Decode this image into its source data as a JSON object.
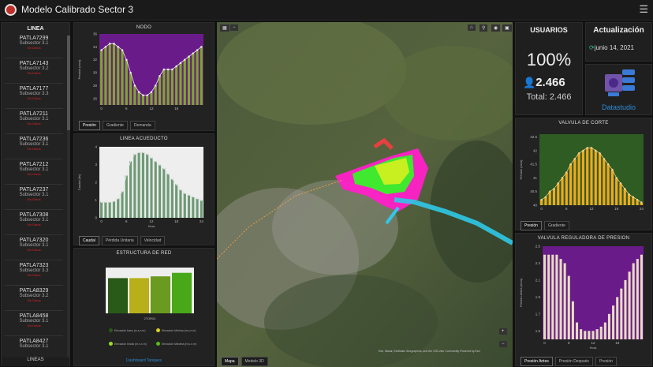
{
  "app": {
    "title": "Modelo Calibrado Sector 3"
  },
  "sidebar": {
    "header": "LINEA",
    "footer": "LINEAS",
    "items": [
      {
        "name": "PATLA7299",
        "sub": "Subsector 3.1",
        "val": "Sin Datos"
      },
      {
        "name": "PATLA7143",
        "sub": "Subsector 3.2",
        "val": "Sin Datos"
      },
      {
        "name": "PATLA7177",
        "sub": "Subsector 3.3",
        "val": "Sin Datos"
      },
      {
        "name": "PATLA7211",
        "sub": "Subsector 3.1",
        "val": "Sin Datos"
      },
      {
        "name": "PATLA7236",
        "sub": "Subsector 3.1",
        "val": "Sin Datos"
      },
      {
        "name": "PATLA7212",
        "sub": "Subsector 3.1",
        "val": "Sin Datos"
      },
      {
        "name": "PATLA7237",
        "sub": "Subsector 3.1",
        "val": "Sin Datos"
      },
      {
        "name": "PATLA7308",
        "sub": "Subsector 3.1",
        "val": "Sin Datos"
      },
      {
        "name": "PATLA7320",
        "sub": "Subsector 3.1",
        "val": "Sin Datos"
      },
      {
        "name": "PATLA7323",
        "sub": "Subsector 3.3",
        "val": "Sin Datos"
      },
      {
        "name": "PATLA8329",
        "sub": "Subsector 3.2",
        "val": "Sin Datos"
      },
      {
        "name": "PATLA8458",
        "sub": "Subsector 3.1",
        "val": "Sin Datos"
      },
      {
        "name": "PATLA8427",
        "sub": "Subsector 3.1",
        "val": ""
      }
    ]
  },
  "nodo": {
    "title": "NODO",
    "tabs": [
      "Presión",
      "Gradiente",
      "Demanda"
    ]
  },
  "acueducto": {
    "title": "LINEA ACUEDUCTO",
    "tabs": [
      "Caudal",
      "Pérdida Unitaria",
      "Velocidad"
    ],
    "xlabel": "Hora"
  },
  "estructura": {
    "title": "ESTRUCTURA DE RED",
    "link": "Dashboard Tanques",
    "legend": [
      "Elevación base (m.s.n.m)",
      "Elevación Mínima (m.s.n.m)",
      "Elevación Inicial (m.s.n.m)",
      "Elevación Máxima (m.s.n.m)"
    ]
  },
  "map": {
    "tabs": [
      "Mapa",
      "Modelo 3D"
    ],
    "attribution": "Esri, Maxar, Earthstar Geographics, and the GIS User Community   Powered by Esri"
  },
  "usuarios": {
    "label": "USUARIOS",
    "percent": "100%",
    "count": "2.466",
    "total": "Total: 2.466"
  },
  "actualizacion": {
    "label": "Actualización",
    "date": "junio 14, 2021"
  },
  "datastudio": {
    "label": "Datastudio"
  },
  "valvula_corte": {
    "title": "VALVULA DE CORTE",
    "tabs": [
      "Presión",
      "Gradiente"
    ],
    "xlabel": "Hora"
  },
  "valvula_reg": {
    "title": "VALVULA REGULADORA DE PRESION",
    "tabs": [
      "Presión Antes",
      "Presión Después",
      "Presión"
    ],
    "xlabel": "Hora"
  },
  "colors": {
    "accent": "#2d8cd6",
    "nodo_fill": "#6a1b8a",
    "green": "#7ca828",
    "amber": "#f2a81d",
    "beige": "#e6dcc0"
  },
  "chart_data": [
    {
      "id": "nodo",
      "type": "bar",
      "x": [
        0,
        1,
        2,
        3,
        4,
        5,
        6,
        7,
        8,
        9,
        10,
        11,
        12,
        13,
        14,
        15,
        16,
        17,
        18,
        19,
        20,
        21,
        22,
        23,
        24
      ],
      "values": [
        33.5,
        34,
        34.5,
        34.5,
        34,
        33.5,
        32,
        30,
        28,
        27,
        26.5,
        26.5,
        27,
        28,
        29.5,
        30.5,
        30.5,
        30.5,
        31,
        31.5,
        32,
        32.5,
        33,
        33.5,
        34
      ],
      "ylim": [
        25,
        36
      ],
      "yticks": [
        26,
        28,
        30,
        32,
        34,
        36
      ],
      "xticks": [
        0,
        6,
        12,
        18
      ],
      "ylabel": "Presión (mca)"
    },
    {
      "id": "acueducto",
      "type": "bar",
      "x": [
        0,
        1,
        2,
        3,
        4,
        5,
        6,
        7,
        8,
        9,
        10,
        11,
        12,
        13,
        14,
        15,
        16,
        17,
        18,
        19,
        20,
        21,
        22,
        23,
        24
      ],
      "values": [
        0.9,
        0.9,
        0.9,
        0.95,
        1.1,
        1.5,
        2.4,
        3.2,
        3.6,
        3.7,
        3.7,
        3.6,
        3.4,
        3.2,
        3.0,
        2.8,
        2.5,
        2.2,
        1.9,
        1.6,
        1.4,
        1.3,
        1.2,
        1.1,
        1.0
      ],
      "ylim": [
        0,
        4
      ],
      "yticks": [
        0,
        1,
        2,
        3,
        4
      ],
      "xticks": [
        0,
        6,
        12,
        18,
        24
      ],
      "ylabel": "Caudal (l/s)",
      "xlabel": "Hora"
    },
    {
      "id": "estructura",
      "type": "bar",
      "categories": [
        "Elevación base",
        "Elevación Mínima",
        "Elevación Inicial",
        "Elevación Máxima"
      ],
      "values": [
        2800,
        2800,
        2801,
        2803
      ],
      "ylim": [
        2780,
        2806
      ],
      "xlabel": "2TOR01"
    },
    {
      "id": "valvula_corte",
      "type": "bar",
      "x": [
        0,
        1,
        2,
        3,
        4,
        5,
        6,
        7,
        8,
        9,
        10,
        11,
        12,
        13,
        14,
        15,
        16,
        17,
        18,
        19,
        20,
        21,
        22,
        23,
        24
      ],
      "values": [
        40.2,
        40.3,
        40.5,
        40.6,
        40.8,
        41.0,
        41.2,
        41.5,
        41.7,
        41.9,
        42.0,
        42.1,
        42.1,
        42.0,
        41.9,
        41.7,
        41.5,
        41.3,
        41.0,
        40.8,
        40.6,
        40.4,
        40.3,
        40.2,
        40.1
      ],
      "ylim": [
        40,
        42.6
      ],
      "yticks": [
        40,
        40.5,
        41,
        41.5,
        42,
        42.5
      ],
      "xticks": [
        0,
        6,
        12,
        18,
        24
      ],
      "ylabel": "Presión (mca)"
    },
    {
      "id": "valvula_reg",
      "type": "bar",
      "x": [
        0,
        1,
        2,
        3,
        4,
        5,
        6,
        7,
        8,
        9,
        10,
        11,
        12,
        13,
        14,
        15,
        16,
        17,
        18,
        19,
        20,
        21,
        22,
        23,
        24
      ],
      "values": [
        2.4,
        2.4,
        2.4,
        2.4,
        2.35,
        2.3,
        2.15,
        1.85,
        1.6,
        1.52,
        1.5,
        1.5,
        1.5,
        1.52,
        1.55,
        1.6,
        1.7,
        1.8,
        1.9,
        2.0,
        2.1,
        2.2,
        2.3,
        2.35,
        2.4
      ],
      "ylim": [
        1.4,
        2.5
      ],
      "yticks": [
        1.5,
        1.7,
        1.9,
        2.1,
        2.3,
        2.5
      ],
      "xticks": [
        0,
        6,
        12,
        18
      ],
      "ylabel": "Presión Antes (mca)",
      "xlabel": "Hora"
    }
  ]
}
